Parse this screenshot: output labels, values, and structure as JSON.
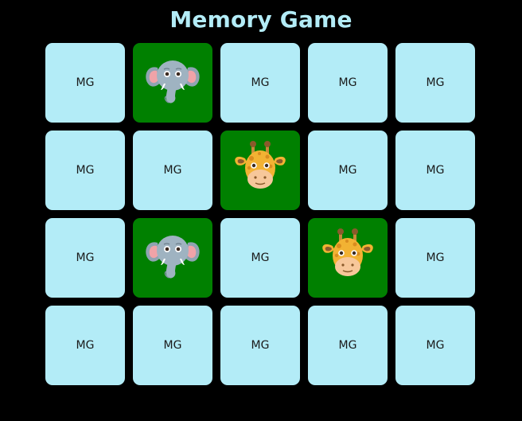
{
  "title": "Memory Game",
  "card_back_label": "MG",
  "colors": {
    "background": "#000000",
    "title": "#b3ecf7",
    "card_back": "#b3ecf7",
    "card_revealed": "#008000",
    "card_text": "#1a1a1a"
  },
  "board": {
    "columns": 5,
    "rows": 4,
    "cards": [
      {
        "state": "hidden",
        "label": "MG"
      },
      {
        "state": "revealed",
        "animal": "elephant-icon"
      },
      {
        "state": "hidden",
        "label": "MG"
      },
      {
        "state": "hidden",
        "label": "MG"
      },
      {
        "state": "hidden",
        "label": "MG"
      },
      {
        "state": "hidden",
        "label": "MG"
      },
      {
        "state": "hidden",
        "label": "MG"
      },
      {
        "state": "revealed",
        "animal": "giraffe-icon"
      },
      {
        "state": "hidden",
        "label": "MG"
      },
      {
        "state": "hidden",
        "label": "MG"
      },
      {
        "state": "hidden",
        "label": "MG"
      },
      {
        "state": "revealed",
        "animal": "elephant-icon"
      },
      {
        "state": "hidden",
        "label": "MG"
      },
      {
        "state": "revealed",
        "animal": "giraffe-icon"
      },
      {
        "state": "hidden",
        "label": "MG"
      },
      {
        "state": "hidden",
        "label": "MG"
      },
      {
        "state": "hidden",
        "label": "MG"
      },
      {
        "state": "hidden",
        "label": "MG"
      },
      {
        "state": "hidden",
        "label": "MG"
      },
      {
        "state": "hidden",
        "label": "MG"
      }
    ]
  }
}
